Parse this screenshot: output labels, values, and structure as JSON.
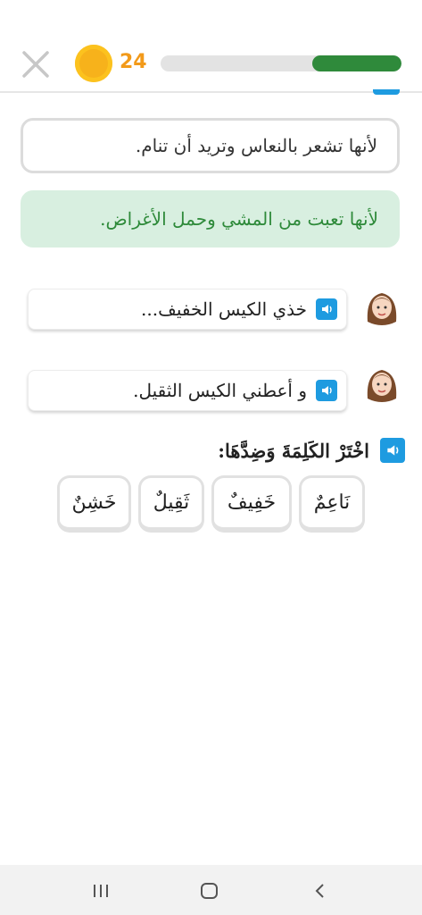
{
  "header": {
    "coin_count": "24",
    "progress_fraction": 0.37,
    "colors": {
      "coin": "#f7b21b",
      "progress_fill": "#2f8a3b",
      "progress_track": "#e3e3e3"
    }
  },
  "options": [
    {
      "text": "لأنها تشعر بالنعاس وتريد أن تنام.",
      "state": "unselected"
    },
    {
      "text": "لأنها تعبت من المشي وحمل الأغراض.",
      "state": "correct"
    }
  ],
  "dialogue": [
    {
      "text": "خذي الكيس الخفيف...",
      "speaker_icon": "speaker-icon",
      "avatar": "girl-avatar"
    },
    {
      "text": "و أعطني الكيس الثقيل.",
      "speaker_icon": "speaker-icon",
      "avatar": "girl-avatar"
    }
  ],
  "instruction": {
    "text": "اخْتَرْ الكَلِمَةَ وَضِدَّهَا:"
  },
  "word_choices": [
    "نَاعِمٌ",
    "خَفِيفٌ",
    "ثَقِيلٌ",
    "خَشِنٌ"
  ],
  "nav": {
    "icons": [
      "recent-apps-icon",
      "home-icon",
      "back-icon"
    ]
  }
}
